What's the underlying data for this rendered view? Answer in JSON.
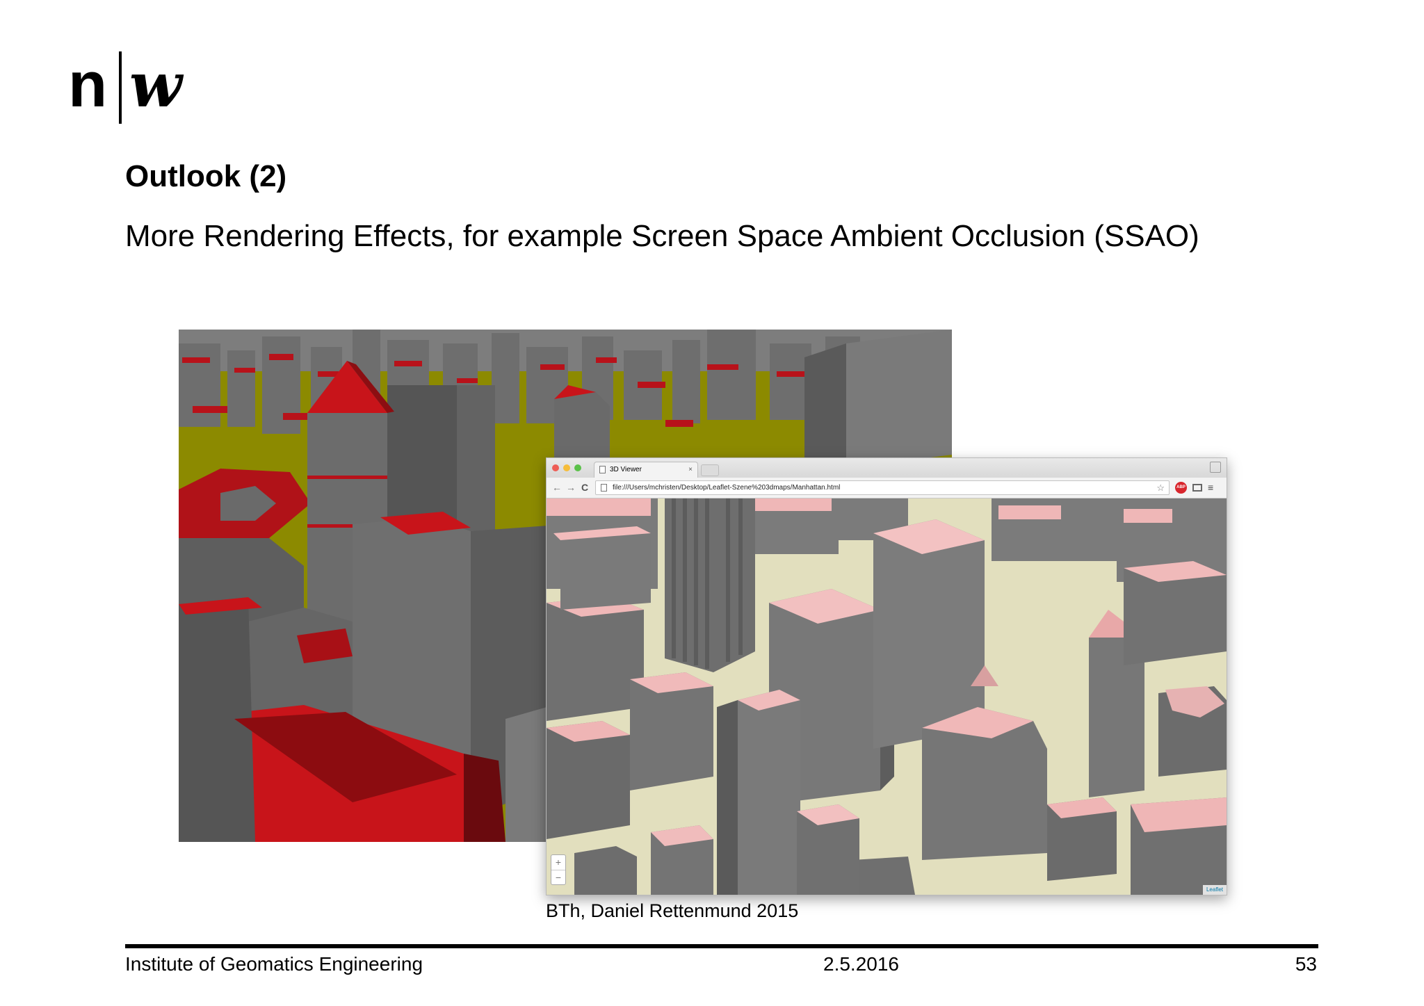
{
  "logo": {
    "left_glyph": "n",
    "right_glyph": "w"
  },
  "slide": {
    "title": "Outlook (2)",
    "subtitle": "More Rendering Effects, for example Screen Space Ambient Occlusion (SSAO)"
  },
  "browser": {
    "tab_title": "3D Viewer",
    "tab_close": "×",
    "url": "file:///Users/mchristen/Desktop/Leaflet-Szene%203dmaps/Manhattan.html",
    "back": "←",
    "forward": "→",
    "reload": "C",
    "adblock_label": "ABP",
    "menu": "≡",
    "star": "☆",
    "zoom_in": "+",
    "zoom_out": "−",
    "attribution": "Leaflet"
  },
  "caption": "BTh, Daniel Rettenmund 2015",
  "footer": {
    "institute": "Institute of Geomatics Engineering",
    "date": "2.5.2016",
    "page": "53"
  },
  "colors": {
    "roof_red": "#c8141a",
    "ground_olive": "#8c8a00",
    "building_grey": "#6b6b6b",
    "roof_pink": "#f0b8b8",
    "ground_cream": "#e8e4c4"
  }
}
